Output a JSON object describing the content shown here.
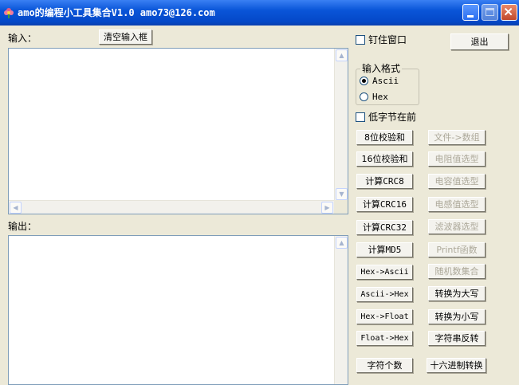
{
  "window": {
    "title": "amo的编程小工具集合V1.0  amo73@126.com",
    "icon": "app-flower-icon"
  },
  "input": {
    "label": "输入：",
    "clear_button": "清空输入框",
    "value": ""
  },
  "output": {
    "label": "输出：",
    "value": ""
  },
  "options": {
    "pin_window_label": "钉住窗口",
    "pin_window_checked": false,
    "exit_button": "退出",
    "input_format_title": "输入格式",
    "format_ascii": "Ascii",
    "format_hex": "Hex",
    "selected_format": "Ascii",
    "low_byte_first_label": "低字节在前",
    "low_byte_first_checked": false
  },
  "buttons_left": [
    "8位校验和",
    "16位校验和",
    "计算CRC8",
    "计算CRC16",
    "计算CRC32",
    "计算MD5",
    "Hex->Ascii",
    "Ascii->Hex",
    "Hex->Float",
    "Float->Hex",
    "字符个数"
  ],
  "buttons_right": [
    "文件->数组",
    "电阻值选型",
    "电容值选型",
    "电感值选型",
    "滤波器选型",
    "Printf函数",
    "随机数集合",
    "转换为大写",
    "转换为小写",
    "字符串反转",
    "十六进制转换"
  ]
}
